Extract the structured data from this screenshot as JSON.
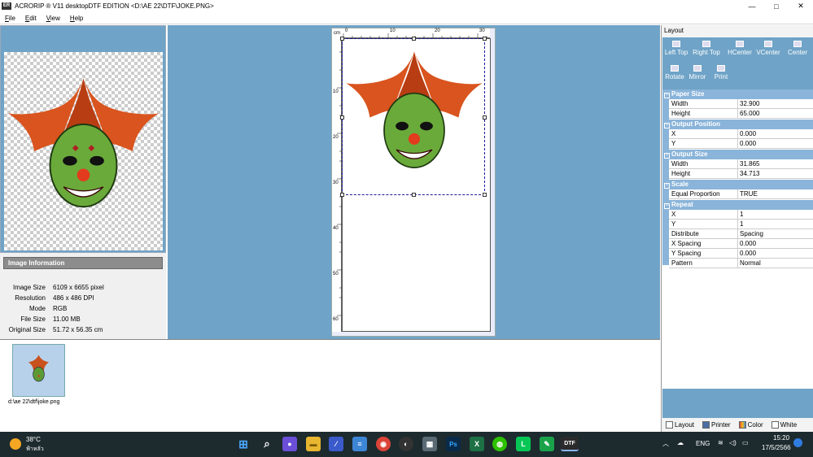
{
  "window": {
    "icon_label": "ER",
    "title": "ACRORIP ® V11 desktopDTF EDITION <D:\\AE 22\\DTF\\JOKE.PNG>",
    "controls": [
      "—",
      "□",
      "✕"
    ]
  },
  "menu": [
    "File",
    "Edit",
    "View",
    "Help"
  ],
  "image_info": {
    "header": "Image Information",
    "rows": [
      {
        "label": "Image Size",
        "value": "6109 x 6655 pixel"
      },
      {
        "label": "Resolution",
        "value": "486 x 486 DPI"
      },
      {
        "label": "Mode",
        "value": "RGB"
      },
      {
        "label": "File Size",
        "value": "11.00 MB"
      },
      {
        "label": "Original Size",
        "value": "51.72 x 56.35 cm"
      }
    ]
  },
  "ruler": {
    "unit": "cm",
    "top_labels": [
      "0",
      "10",
      "20",
      "30"
    ],
    "left_labels": [
      "10",
      "20",
      "30",
      "40",
      "50",
      "60"
    ]
  },
  "thumbnail": {
    "label": "d:\\ae 22\\dtf\\joke.png"
  },
  "panel": {
    "title": "Layout",
    "tools": [
      {
        "label": "Left Top",
        "icon": "left-top-icon"
      },
      {
        "label": "Right Top",
        "icon": "right-top-icon"
      },
      {
        "label": "HCenter",
        "icon": "hcenter-icon"
      },
      {
        "label": "VCenter",
        "icon": "vcenter-icon"
      },
      {
        "label": "Center",
        "icon": "center-icon"
      },
      {
        "label": "Rotate",
        "icon": "rotate-icon"
      },
      {
        "label": "Mirror",
        "icon": "mirror-icon"
      },
      {
        "label": "Print",
        "icon": "print-icon"
      }
    ],
    "sections": [
      {
        "title": "Paper Size",
        "rows": [
          {
            "k": "Width",
            "v": "32.900"
          },
          {
            "k": "Height",
            "v": "65.000"
          }
        ]
      },
      {
        "title": "Output Position",
        "rows": [
          {
            "k": "X",
            "v": "0.000"
          },
          {
            "k": "Y",
            "v": "0.000"
          }
        ]
      },
      {
        "title": "Output Size",
        "rows": [
          {
            "k": "Width",
            "v": "31.865"
          },
          {
            "k": "Height",
            "v": "34.713"
          }
        ]
      },
      {
        "title": "Scale",
        "rows": [
          {
            "k": "Equal Proportion",
            "v": "TRUE"
          }
        ]
      },
      {
        "title": "Repeat",
        "rows": [
          {
            "k": "X",
            "v": "1"
          },
          {
            "k": "Y",
            "v": "1"
          },
          {
            "k": "Distribute",
            "v": "Spacing"
          },
          {
            "k": "X Spacing",
            "v": "0.000"
          },
          {
            "k": "Y Spacing",
            "v": "0.000"
          },
          {
            "k": "Pattern",
            "v": "Normal"
          }
        ]
      }
    ],
    "tabs": [
      {
        "label": "Layout",
        "color": "#ffffff"
      },
      {
        "label": "Printer",
        "color": "#4a6fa5"
      },
      {
        "label": "Color",
        "color": "#e0443a"
      },
      {
        "label": "White",
        "color": "#ffffff"
      }
    ]
  },
  "taskbar": {
    "weather_temp": "38°C",
    "weather_text": "ฟ้าหลัว",
    "apps": [
      {
        "name": "start-icon",
        "glyph": "⊞",
        "color": "#3a8ee6"
      },
      {
        "name": "search-icon",
        "glyph": "⌕",
        "color": "#1d2b2f"
      },
      {
        "name": "meet-icon",
        "glyph": "●",
        "color": "#6b4fd8"
      },
      {
        "name": "folder-icon",
        "glyph": "▬",
        "color": "#e8b630"
      },
      {
        "name": "app-blue-icon",
        "glyph": "⁄",
        "color": "#3b5bcc"
      },
      {
        "name": "notepad-icon",
        "glyph": "≡",
        "color": "#3d86d6"
      },
      {
        "name": "chrome-icon",
        "glyph": "◉",
        "color": "#db4437"
      },
      {
        "name": "obs-icon",
        "glyph": "◐",
        "color": "#333333"
      },
      {
        "name": "calculator-icon",
        "glyph": "▦",
        "color": "#5a6a75"
      },
      {
        "name": "photoshop-icon",
        "glyph": "Ps",
        "color": "#0a2a4a"
      },
      {
        "name": "excel-icon",
        "glyph": "X",
        "color": "#1e7145"
      },
      {
        "name": "wechat-icon",
        "glyph": "◍",
        "color": "#2dc100"
      },
      {
        "name": "line-icon",
        "glyph": "L",
        "color": "#06c755"
      },
      {
        "name": "edit-green-icon",
        "glyph": "✎",
        "color": "#1aa34a"
      },
      {
        "name": "dtf-icon",
        "glyph": "DTF",
        "color": "#2b2b2b"
      }
    ],
    "lang": "ENG",
    "time": "15:20",
    "date": "17/5/2566"
  }
}
